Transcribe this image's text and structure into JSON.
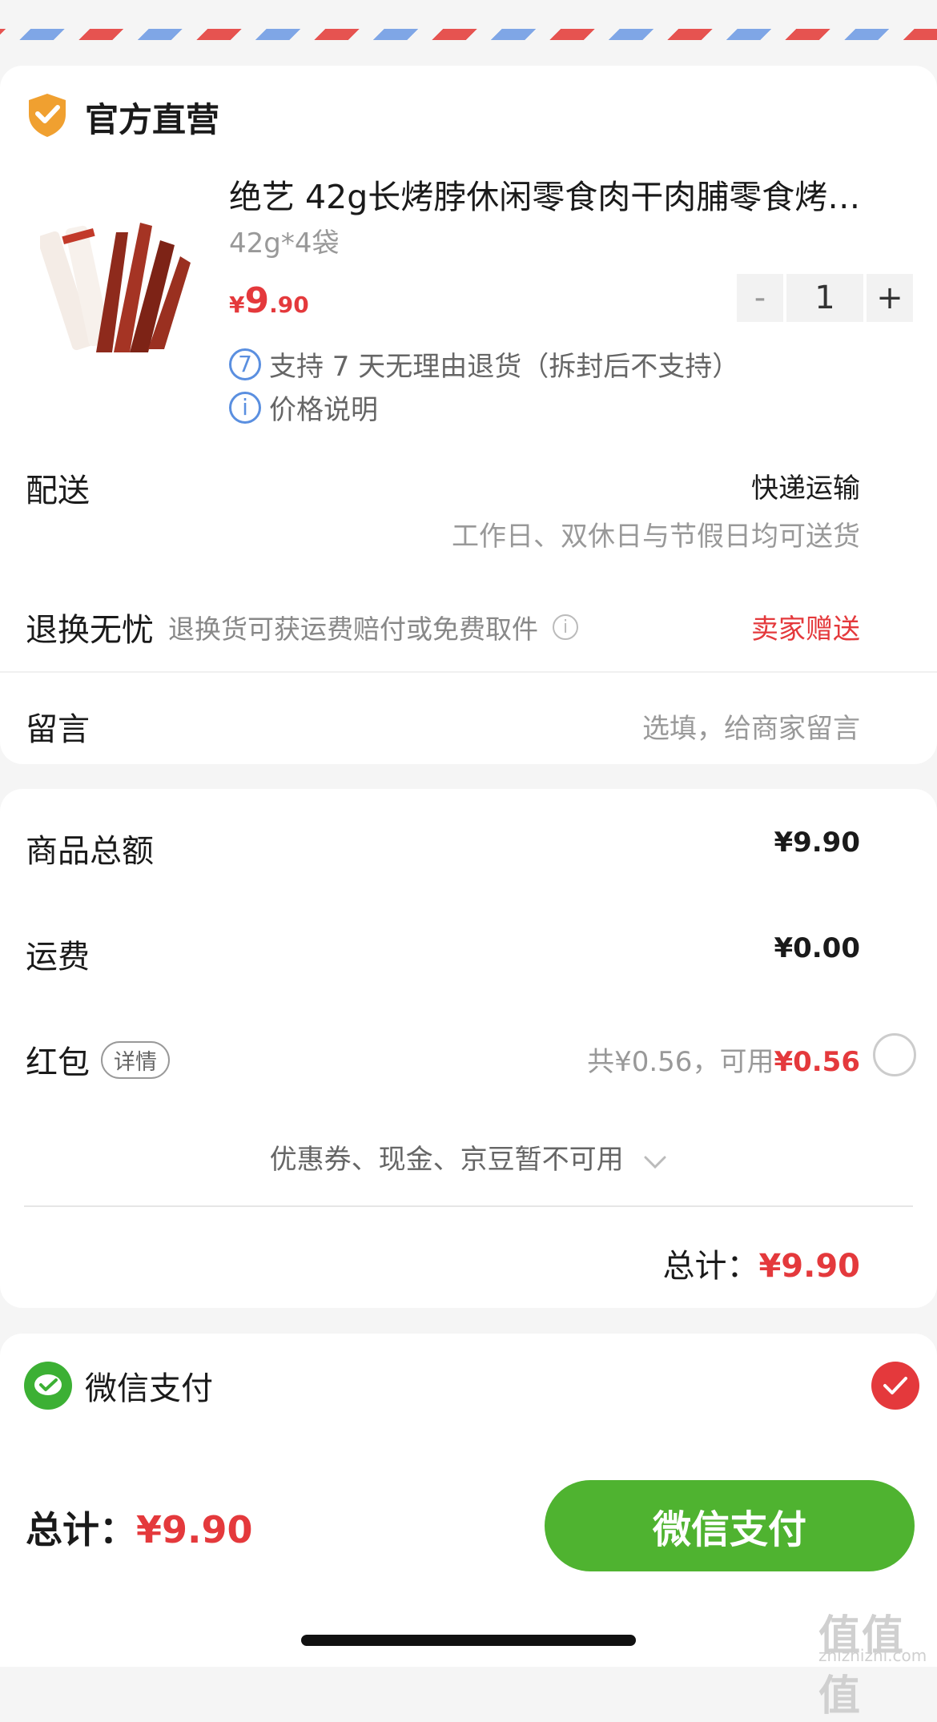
{
  "store": {
    "label": "官方直营",
    "icon": "shield-check-icon",
    "accent": "#f0a030"
  },
  "product": {
    "title": "绝艺 42g长烤脖休闲零食肉干肉脯零食烤…",
    "spec": "42g*4袋",
    "price_currency": "¥",
    "price_int": "9",
    "price_dec": ".90",
    "qty_minus": "-",
    "qty": "1",
    "qty_plus": "+",
    "return_badge": "7",
    "return_policy": "支持 7 天无理由退货（拆封后不支持）",
    "price_note_icon": "i",
    "price_note": "价格说明"
  },
  "delivery": {
    "label": "配送",
    "method": "快递运输",
    "detail": "工作日、双休日与节假日均可送货"
  },
  "return_worry": {
    "label": "退换无忧",
    "desc": "退换货可获运费赔付或免费取件",
    "info_icon": "i",
    "value": "卖家赠送"
  },
  "message": {
    "label": "留言",
    "placeholder": "选填，给商家留言"
  },
  "summary": {
    "goods_label": "商品总额",
    "goods_value": "¥9.90",
    "shipping_label": "运费",
    "shipping_value": "¥0.00",
    "redpacket_label": "红包",
    "redpacket_tag": "详情",
    "redpacket_total": "共¥0.56，可用",
    "redpacket_avail": "¥0.56",
    "coupon_note": "优惠券、现金、京豆暂不可用",
    "total_label": "总计：",
    "total_value": "¥9.90"
  },
  "payment": {
    "method": "微信支付"
  },
  "footer": {
    "total_label": "总计：",
    "total_value": "¥9.90",
    "pay_button": "微信支付"
  },
  "watermark": {
    "text": "值值值",
    "url": "zhizhizhi.com"
  },
  "colors": {
    "price_red": "#e4393c",
    "wechat_green": "#4fb330",
    "link_blue": "#5a8fe0"
  }
}
